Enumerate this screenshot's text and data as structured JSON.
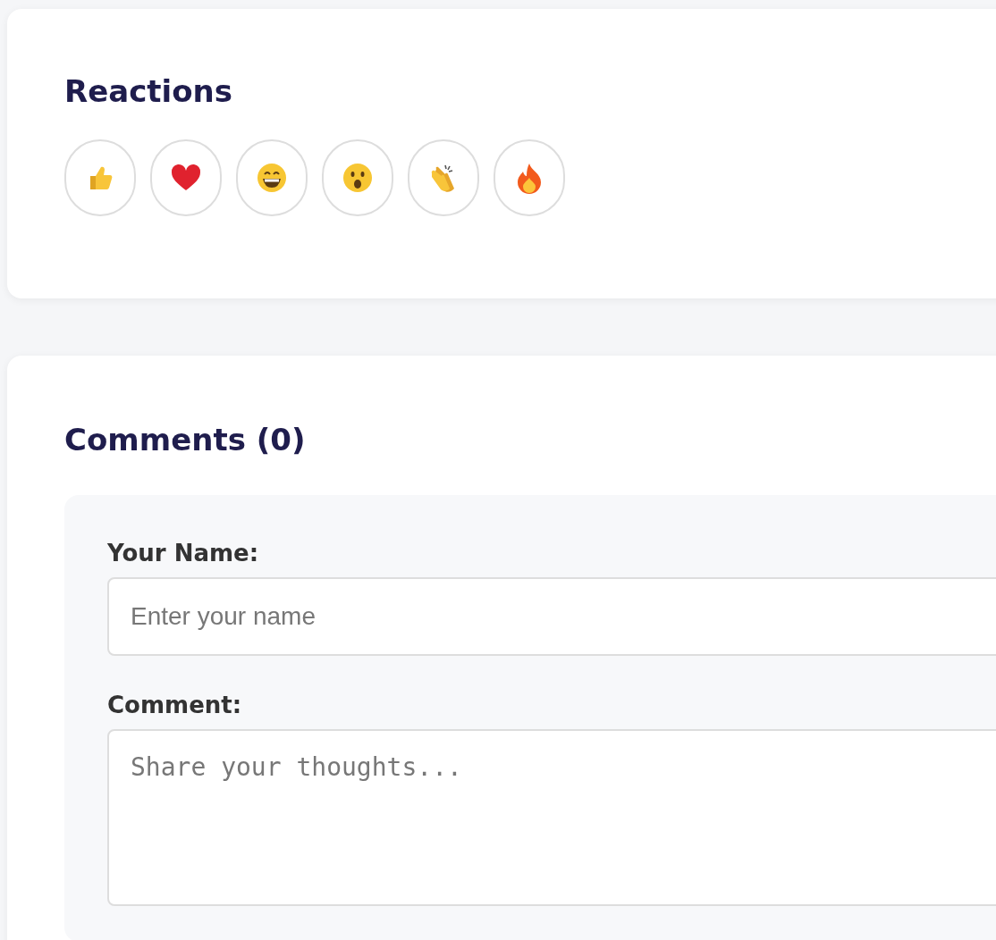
{
  "reactions_card": {
    "title": "Reactions",
    "reactions": [
      {
        "kind": "thumbs-up"
      },
      {
        "kind": "heart"
      },
      {
        "kind": "grin"
      },
      {
        "kind": "surprised"
      },
      {
        "kind": "clap"
      },
      {
        "kind": "fire"
      }
    ]
  },
  "comments_card": {
    "title": "Comments (0)",
    "form": {
      "name_label": "Your Name:",
      "name_placeholder": "Enter your name",
      "comment_label": "Comment:",
      "comment_placeholder": "Share your thoughts..."
    }
  }
}
